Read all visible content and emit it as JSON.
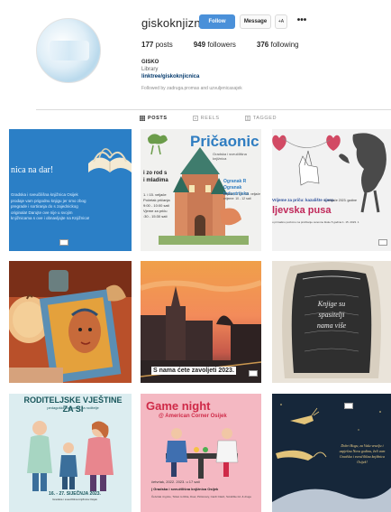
{
  "profile": {
    "username": "giskoknjiznica",
    "follow_label": "Follow",
    "message_label": "Message",
    "add_user_label": "+A",
    "more_label": "•••",
    "stats": {
      "posts": "177",
      "posts_label": "posts",
      "followers": "949",
      "followers_label": "followers",
      "following": "376",
      "following_label": "following"
    },
    "bio_name": "GISKO",
    "bio_category": "Library",
    "bio_link": "linktree/giskoknjicnica",
    "followed_by": "Followed by zadruga.promas and uzvuljenicasajek"
  },
  "tabs": [
    {
      "label": "POSTS",
      "active": true
    },
    {
      "label": "REELS",
      "active": false
    },
    {
      "label": "TAGGED",
      "active": false
    }
  ],
  "posts": {
    "p1": {
      "title": "nica na dar!",
      "body": "Gradska i sveučilišna knjižnica Osijek prodaje vam prigodnu knjigu jer smo zbog pregrade i sortiranja do s zajednickog originala! Darujte ove nije u svojim knjižnicama s ove i obnavljajte na Knjižnica!"
    },
    "p2": {
      "title": "Pričaonic",
      "sub": "Gradska i sveučilišna knjižnica",
      "left_big": "i zo rod s\ni mladima",
      "left_small": "1. i 15. veljače\nPočetak pričanja\n9:00 - 10:00 sati\nVjeme za priču\n:30 - 15:30 sati",
      "right_big": "Ogranak R\nOgranak Industrijska",
      "right_small": "veljače, 1. 15. i 22. veljače\nvrijeme: 10 - 12 sati"
    },
    "p3": {
      "blue": "Vrijeme za priču: kazalište sjena",
      "date": "4. veljače 2023. godine",
      "big": "ljevska pusa",
      "footer": "u primašnu pozivmo na pročitanje osnovne škole 5 godina 1. 15. 2023. 1"
    },
    "p5": {
      "caption": "S nama ćete zavoljeti 2023."
    },
    "p6": {
      "frame_text": "Knjige su spasitelji, nama više..."
    },
    "p7": {
      "title": "RODITELJSKE VJEŠTINE ZA SI",
      "sub": "pedagoške radionice za roditelje",
      "date": "16. - 27. SIJEČNJA 2023.",
      "small": "Gradska i sveučilišna knjižnica Osijek"
    },
    "p8": {
      "title": "Game night",
      "sub": "@ American Corner Osijek",
      "info": "četvrtak, 2022. 2023. u 17 sati",
      "info2": "| Gradska i sveučilišna knjižnica Osijek",
      "info3": "Četvrtak 4 igrice, Ticket to Ride, Duel, Pictionary, Cardi Clash, Scrabble itd. & druge"
    },
    "p9": {
      "text": "Dobri Bogu, za Vašu veselju i uspješnu Novu godinu, želi vam Gradska i sveučilišna knjižnica Osijek!"
    }
  },
  "colors": {
    "follow_bg": "#4a90d9",
    "link": "#00376b",
    "divider": "#dbdbdb"
  }
}
